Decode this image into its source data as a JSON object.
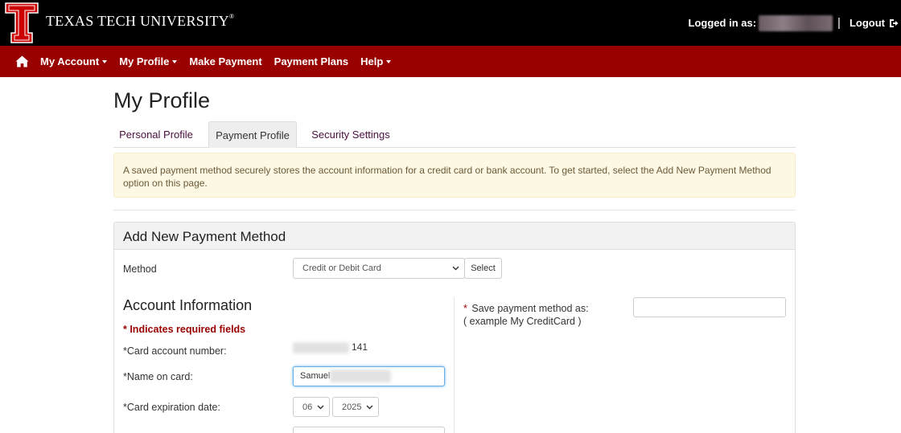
{
  "header": {
    "brand": "TEXAS TECH UNIVERSITY",
    "brand_mark": "®",
    "logged_in_label": "Logged in as:",
    "divider": "|",
    "logout": "Logout"
  },
  "nav": {
    "items": [
      {
        "label": "My Account",
        "dropdown": true
      },
      {
        "label": "My Profile",
        "dropdown": true
      },
      {
        "label": "Make Payment",
        "dropdown": false
      },
      {
        "label": "Payment Plans",
        "dropdown": false
      },
      {
        "label": "Help",
        "dropdown": true
      }
    ]
  },
  "page": {
    "title": "My Profile",
    "tabs": [
      {
        "label": "Personal Profile",
        "active": false
      },
      {
        "label": "Payment Profile",
        "active": true
      },
      {
        "label": "Security Settings",
        "active": false
      }
    ],
    "alert": "A saved payment method securely stores the account information for a credit card or bank account. To get started, select the Add New Payment Method option on this page."
  },
  "panel": {
    "title": "Add New Payment Method",
    "method_label": "Method",
    "method_value": "Credit or Debit Card",
    "select_button": "Select",
    "account_info_title": "Account Information",
    "required_note": "* Indicates required fields",
    "card_number_label": "*Card account number:",
    "card_number_value": "141",
    "name_label": "*Name on card:",
    "name_value": "Samuel",
    "expiration_label": "*Card expiration date:",
    "exp_month": "06",
    "exp_year": "2025",
    "save_as_label": "* Save payment method as:",
    "save_as_example": "( example My CreditCard )"
  },
  "colors": {
    "topbar": "#000000",
    "nav": "#990000",
    "accent": "#990000",
    "alert_bg": "#fcf8e3"
  }
}
